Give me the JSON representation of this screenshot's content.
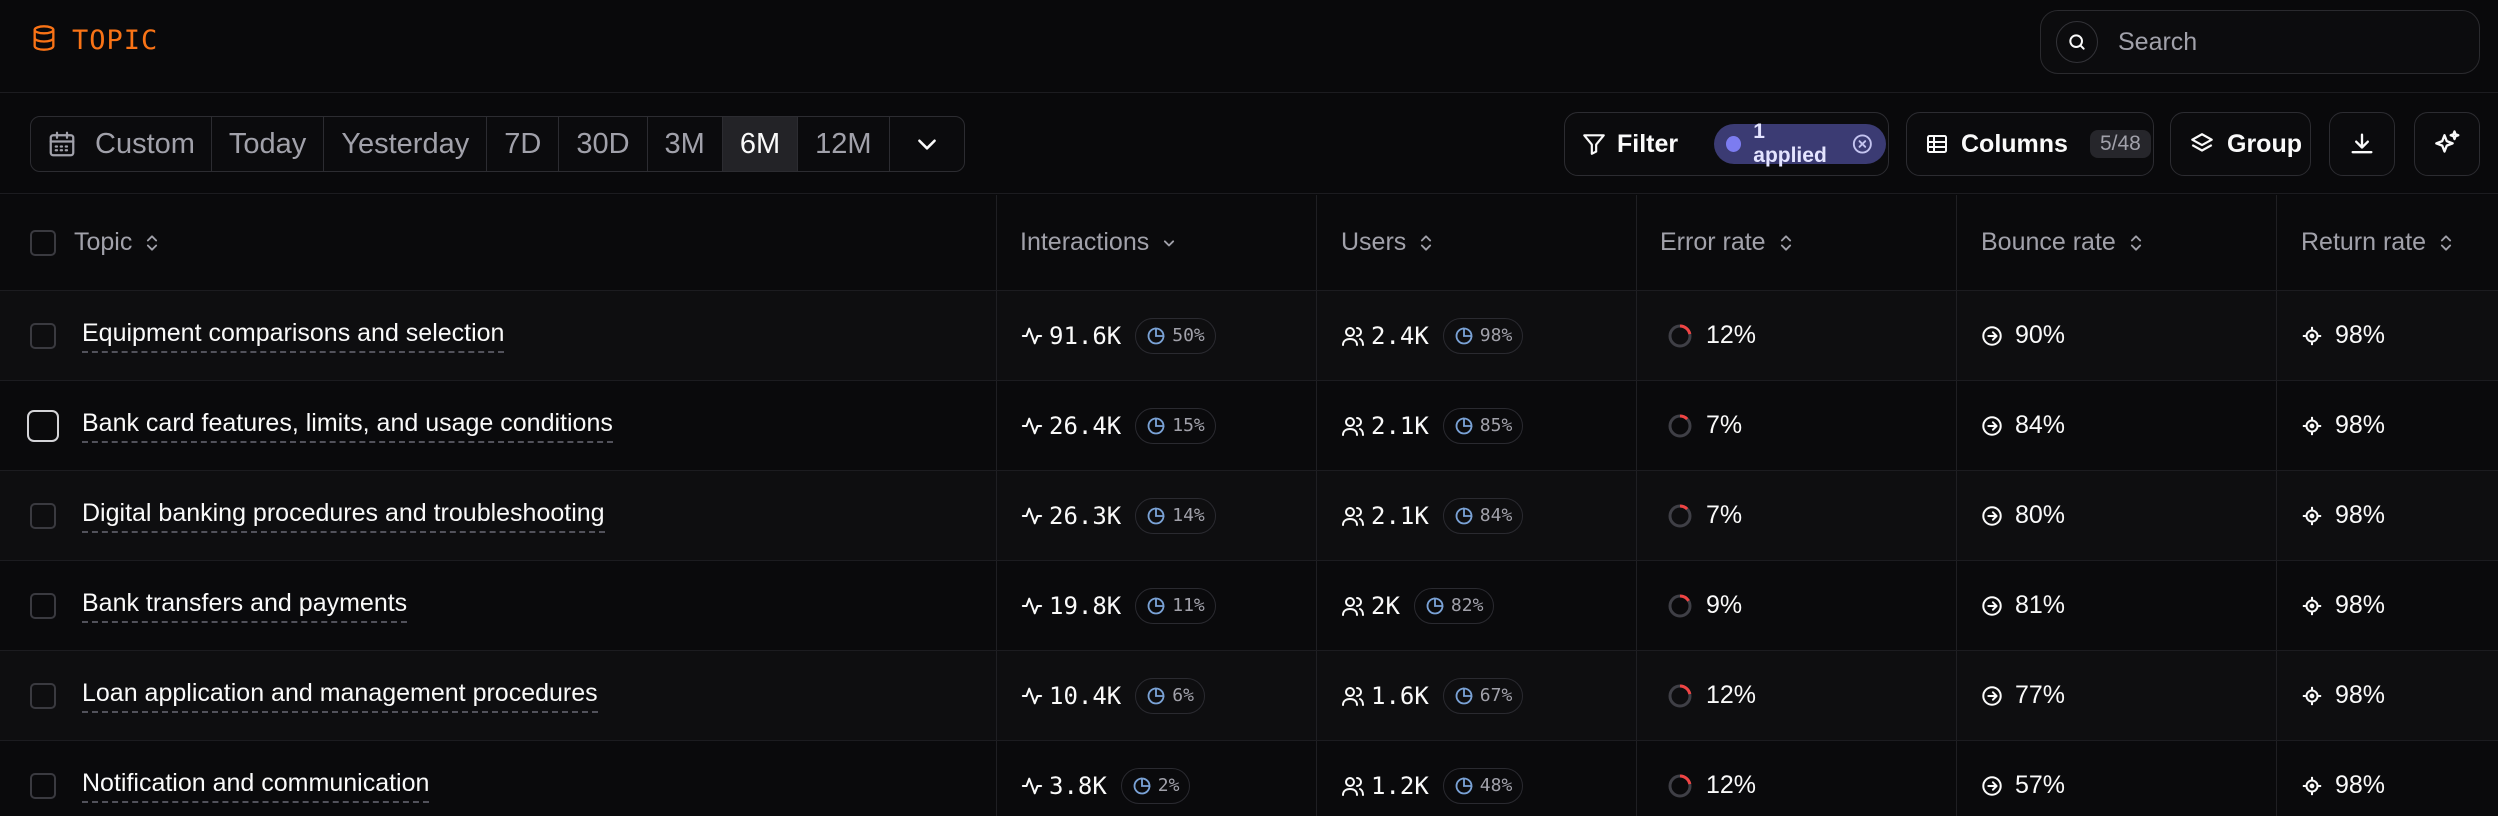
{
  "header": {
    "brand": "TOPIC",
    "search_placeholder": "Search"
  },
  "date_range": {
    "options": [
      "Custom",
      "Today",
      "Yesterday",
      "7D",
      "30D",
      "3M",
      "6M",
      "12M"
    ],
    "selected": "6M"
  },
  "toolbar": {
    "filter_label": "Filter",
    "filter_applied": "1 applied",
    "columns_label": "Columns",
    "columns_count": "5/48",
    "group_label": "Group"
  },
  "table": {
    "columns": [
      "Topic",
      "Interactions",
      "Users",
      "Error rate",
      "Bounce rate",
      "Return rate"
    ],
    "rows": [
      {
        "topic": "Equipment comparisons and selection",
        "interactions": "91.6K",
        "interactions_share": "50%",
        "users": "2.4K",
        "users_share": "98%",
        "error_rate": "12%",
        "bounce_rate": "90%",
        "return_rate": "98%"
      },
      {
        "topic": "Bank card features, limits, and usage conditions",
        "interactions": "26.4K",
        "interactions_share": "15%",
        "users": "2.1K",
        "users_share": "85%",
        "error_rate": "7%",
        "bounce_rate": "84%",
        "return_rate": "98%"
      },
      {
        "topic": "Digital banking procedures and troubleshooting",
        "interactions": "26.3K",
        "interactions_share": "14%",
        "users": "2.1K",
        "users_share": "84%",
        "error_rate": "7%",
        "bounce_rate": "80%",
        "return_rate": "98%"
      },
      {
        "topic": "Bank transfers and payments",
        "interactions": "19.8K",
        "interactions_share": "11%",
        "users": "2K",
        "users_share": "82%",
        "error_rate": "9%",
        "bounce_rate": "81%",
        "return_rate": "98%"
      },
      {
        "topic": "Loan application and management procedures",
        "interactions": "10.4K",
        "interactions_share": "6%",
        "users": "1.6K",
        "users_share": "67%",
        "error_rate": "12%",
        "bounce_rate": "77%",
        "return_rate": "98%"
      },
      {
        "topic": "Notification and communication",
        "interactions": "3.8K",
        "interactions_share": "2%",
        "users": "1.2K",
        "users_share": "48%",
        "error_rate": "12%",
        "bounce_rate": "57%",
        "return_rate": "98%"
      }
    ]
  },
  "colors": {
    "brand": "#f97316",
    "applied_pill": "#3b3b73",
    "share_icon": "#7aa2d6",
    "error_arc": "#ef4444"
  }
}
